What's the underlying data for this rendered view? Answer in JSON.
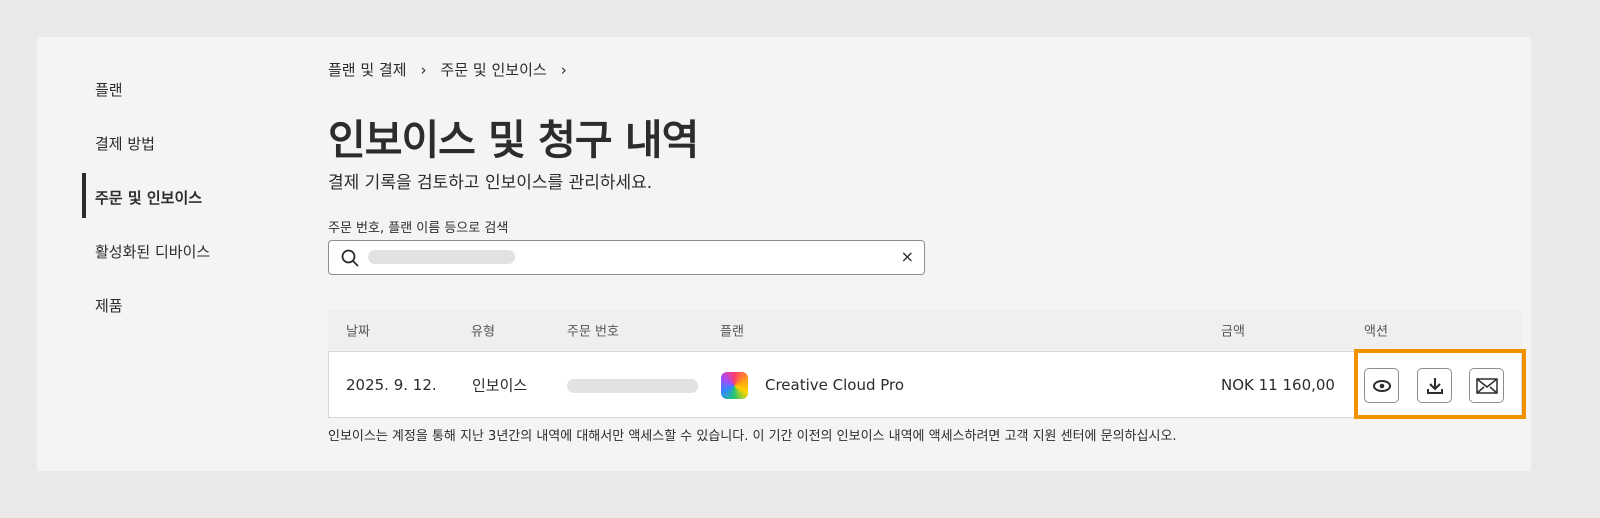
{
  "sidebar": {
    "items": [
      "플랜",
      "결제 방법",
      "주문 및 인보이스",
      "활성화된 디바이스",
      "제품"
    ],
    "active": 2
  },
  "breadcrumb": [
    "플랜 및 결제",
    "주문 및 인보이스"
  ],
  "title": "인보이스 및 청구 내역",
  "subtitle": "결제 기록을 검토하고 인보이스를 관리하세요.",
  "search": {
    "label": "주문 번호, 플랜 이름 등으로 검색",
    "clear": "×"
  },
  "table": {
    "headers": [
      "날짜",
      "유형",
      "주문 번호",
      "플랜",
      "금액",
      "액션"
    ],
    "rows": [
      {
        "date": "2025. 9. 12.",
        "type": "인보이스",
        "plan": "Creative Cloud Pro",
        "amount": "NOK 11 160,00"
      }
    ]
  },
  "note": "인보이스는 계정을 통해 지난 3년간의 내역에 대해서만 액세스할 수 있습니다. 이 기간 이전의 인보이스 내역에 액세스하려면 고객 지원 센터에 문의하십시오.",
  "colors": {
    "highlight": "#f39200"
  }
}
